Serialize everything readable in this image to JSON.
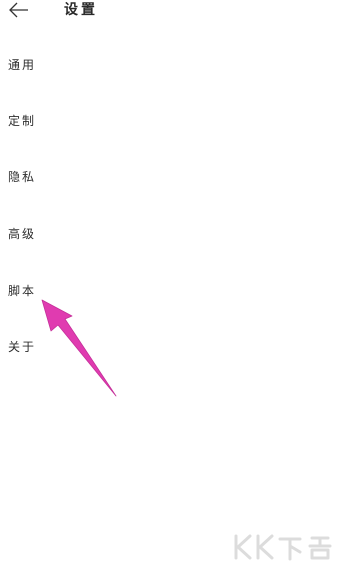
{
  "header": {
    "title": "设置",
    "back_icon": "arrow-left-icon"
  },
  "menu": {
    "items": [
      {
        "id": "general",
        "label": "通用"
      },
      {
        "id": "custom",
        "label": "定制"
      },
      {
        "id": "privacy",
        "label": "隐私"
      },
      {
        "id": "advanced",
        "label": "高级"
      },
      {
        "id": "script",
        "label": "脚本"
      },
      {
        "id": "about",
        "label": "关于"
      }
    ]
  },
  "annotation": {
    "icon": "pointer-arrow-icon",
    "color": "#e03bb0"
  },
  "watermark": {
    "text": "KK下载"
  }
}
